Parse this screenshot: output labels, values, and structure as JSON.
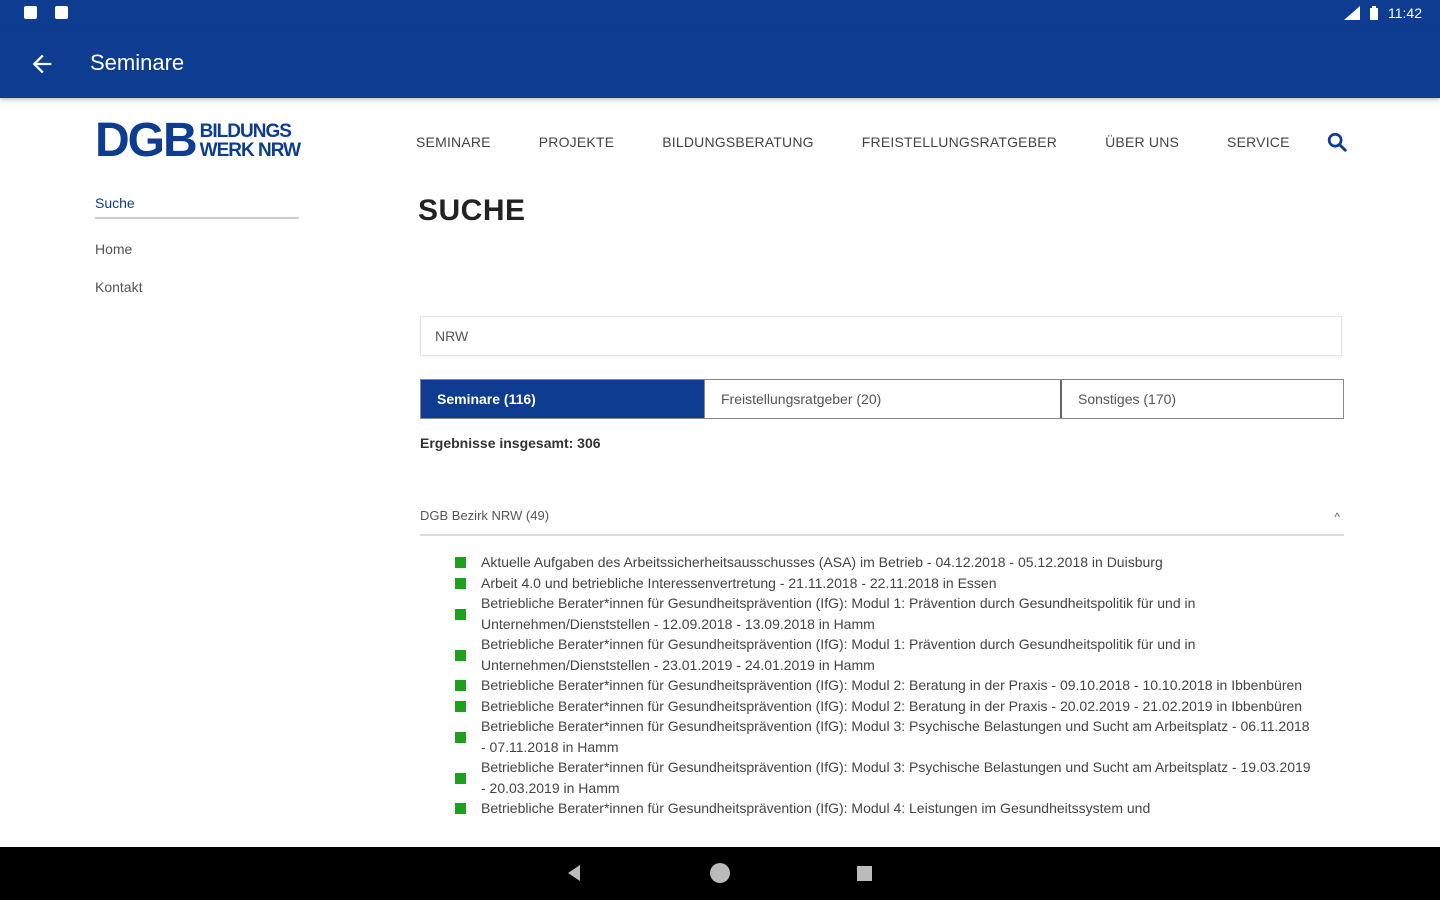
{
  "status_bar": {
    "time": "11:42"
  },
  "app_bar": {
    "title": "Seminare"
  },
  "logo": {
    "big": "DGB",
    "line1": "BILDUNGS",
    "line2": "WERK NRW"
  },
  "top_nav": {
    "items": [
      "SEMINARE",
      "PROJEKTE",
      "BILDUNGSBERATUNG",
      "FREISTELLUNGSRATGEBER",
      "ÜBER UNS",
      "SERVICE"
    ]
  },
  "side_nav": {
    "active": "Suche",
    "links": [
      "Home",
      "Kontakt"
    ]
  },
  "page": {
    "heading": "SUCHE"
  },
  "search": {
    "value": "NRW"
  },
  "tabs": [
    {
      "label": "Seminare (116)",
      "active": true
    },
    {
      "label": "Freistellungsratgeber (20)",
      "active": false
    },
    {
      "label": "Sonstiges (170)",
      "active": false
    }
  ],
  "results_total": "Ergebnisse insgesamt: 306",
  "group": {
    "title": "DGB Bezirk NRW (49)",
    "chevron": "^"
  },
  "results": [
    "Aktuelle Aufgaben des Arbeitssicherheitsausschusses (ASA) im Betrieb   - 04.12.2018 - 05.12.2018 in Duisburg",
    "Arbeit 4.0 und betriebliche Interessenvertretung   - 21.11.2018 - 22.11.2018 in Essen",
    "Betriebliche Berater*innen für Gesundheitsprävention (IfG): Modul 1: Prävention durch Gesundheitspolitik für und in Unternehmen/Dienststellen   - 12.09.2018 - 13.09.2018 in Hamm",
    "Betriebliche Berater*innen für Gesundheitsprävention (IfG): Modul 1: Prävention durch Gesundheitspolitik für und in Unternehmen/Dienststellen   - 23.01.2019 - 24.01.2019 in Hamm",
    "Betriebliche Berater*innen für Gesundheitsprävention (IfG): Modul 2: Beratung in der Praxis   - 09.10.2018 - 10.10.2018 in Ibbenbüren",
    "Betriebliche Berater*innen für Gesundheitsprävention (IfG): Modul 2: Beratung in der Praxis   - 20.02.2019 - 21.02.2019 in Ibbenbüren",
    "Betriebliche Berater*innen für Gesundheitsprävention (IfG): Modul 3: Psychische Belastungen und Sucht am Arbeitsplatz   - 06.11.2018 - 07.11.2018 in Hamm",
    "Betriebliche Berater*innen für Gesundheitsprävention (IfG): Modul 3: Psychische Belastungen und Sucht am Arbeitsplatz   - 19.03.2019 - 20.03.2019 in Hamm",
    "Betriebliche Berater*innen für Gesundheitsprävention (IfG): Modul 4: Leistungen im Gesundheitssystem und"
  ],
  "colors": {
    "brand_blue": "#0d3c91",
    "bullet_green": "#1ea01e"
  },
  "icons": {
    "back": "arrow-left-icon",
    "search": "search-icon"
  }
}
